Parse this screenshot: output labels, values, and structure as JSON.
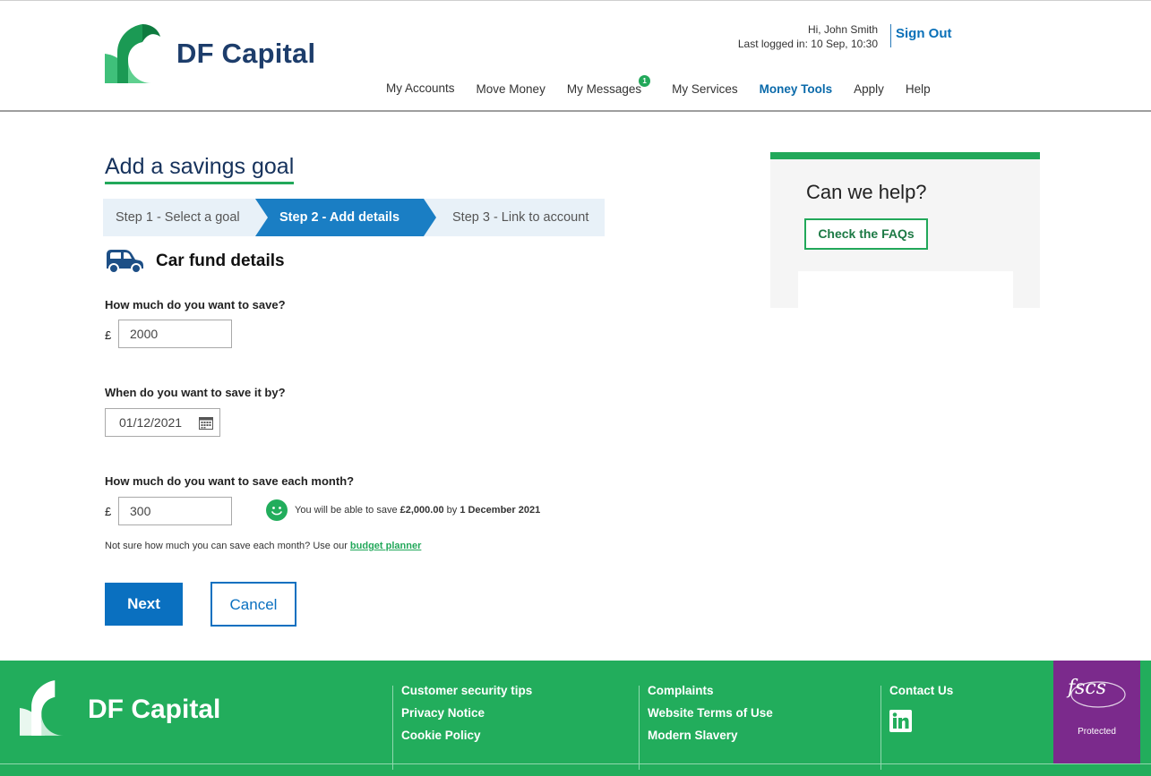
{
  "brand": {
    "name": "DF Capital",
    "primary_color": "#22ad5c",
    "accent_color": "#0a70c0"
  },
  "header": {
    "greeting": "Hi, John Smith",
    "last_login": "Last logged in: 10 Sep, 10:30",
    "sign_out": "Sign Out",
    "nav": [
      {
        "label": "My Accounts"
      },
      {
        "label": "Move Money"
      },
      {
        "label": "My Messages",
        "badge": "1"
      },
      {
        "label": "My Services"
      },
      {
        "label": "Money Tools",
        "active": true
      },
      {
        "label": "Apply"
      },
      {
        "label": "Help"
      }
    ]
  },
  "main": {
    "title": "Add a savings goal",
    "steps": [
      {
        "label": "Step 1 - Select a goal"
      },
      {
        "label": "Step 2 - Add details",
        "active": true
      },
      {
        "label": "Step 3 - Link to account"
      }
    ],
    "section_title": "Car fund details",
    "section_icon": "car-icon",
    "fields": {
      "amount": {
        "label": "How much do you want to save?",
        "currency": "£",
        "value": "2000"
      },
      "date": {
        "label": "When do you want to save it by?",
        "value": "01/12/2021",
        "icon": "calendar-icon"
      },
      "monthly": {
        "label": "How much do you want to save each month?",
        "currency": "£",
        "value": "300"
      }
    },
    "hint": {
      "prefix": "You will be able to save",
      "amount": "£2,000.00",
      "by": "by",
      "date": "1 December 2021"
    },
    "note": {
      "text": "Not sure how much you can save each month? Use our ",
      "link": "budget planner"
    },
    "next": "Next",
    "cancel": "Cancel"
  },
  "help": {
    "title": "Can we help?",
    "button": "Check the FAQs"
  },
  "footer": {
    "col1": [
      "Customer security tips",
      "Privacy Notice",
      "Cookie Policy"
    ],
    "col2": [
      "Complaints",
      "Website Terms of Use",
      "Modern Slavery"
    ],
    "col3": [
      "Contact Us"
    ],
    "fscs_logo": "fscs",
    "fscs_label": "Protected"
  }
}
